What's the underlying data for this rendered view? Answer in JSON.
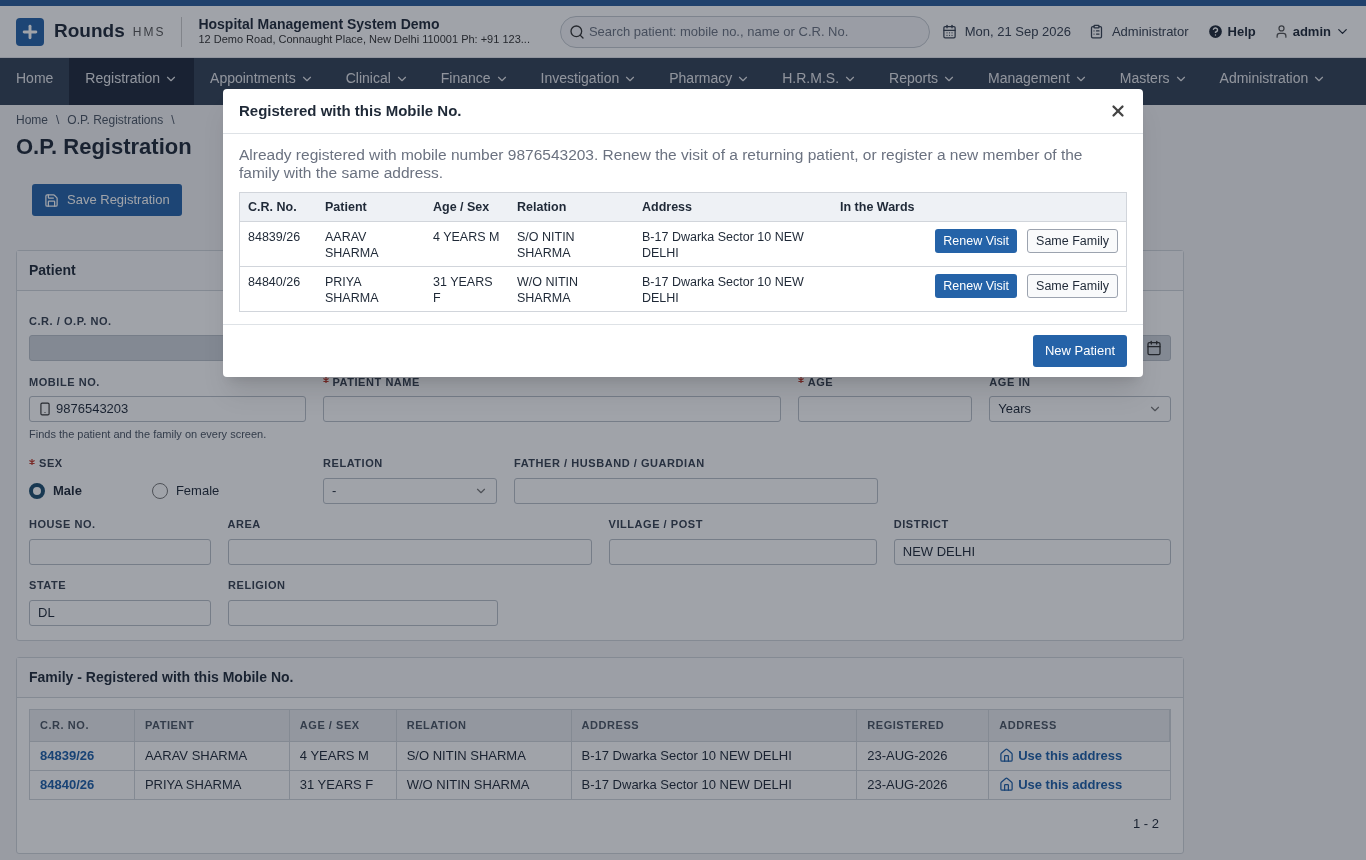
{
  "header": {
    "brand": "Rounds",
    "brand_suffix": "HMS",
    "org_name": "Hospital Management System Demo",
    "org_address": "12 Demo Road, Connaught Place, New Delhi 110001 Ph: +91 123...",
    "search": {
      "placeholder": "Search patient: mobile no., name or C.R. No."
    },
    "date": "Mon, 21 Sep 2026",
    "role": "Administrator",
    "help": "Help",
    "user": "admin"
  },
  "nav": [
    {
      "label": "Home",
      "selected": false,
      "dropdown": false
    },
    {
      "label": "Registration",
      "selected": true,
      "dropdown": true
    },
    {
      "label": "Appointments",
      "selected": false,
      "dropdown": true
    },
    {
      "label": "Clinical",
      "selected": false,
      "dropdown": true
    },
    {
      "label": "Finance",
      "selected": false,
      "dropdown": true
    },
    {
      "label": "Investigation",
      "selected": false,
      "dropdown": true
    },
    {
      "label": "Pharmacy",
      "selected": false,
      "dropdown": true
    },
    {
      "label": "H.R.M.S.",
      "selected": false,
      "dropdown": true
    },
    {
      "label": "Reports",
      "selected": false,
      "dropdown": true
    },
    {
      "label": "Management",
      "selected": false,
      "dropdown": true
    },
    {
      "label": "Masters",
      "selected": false,
      "dropdown": true
    },
    {
      "label": "Administration",
      "selected": false,
      "dropdown": true
    }
  ],
  "breadcrumb": {
    "separator": "\\",
    "items": [
      "Home",
      "O.P. Registrations"
    ]
  },
  "page_title": "O.P. Registration",
  "save_button": "Save Registration",
  "patient_panel": {
    "title": "Patient",
    "rows": [
      [
        {
          "kind": "text",
          "label": "C.R. / O.P. NO.",
          "required": false,
          "disabled": true
        },
        {
          "kind": "date",
          "disabled": true
        }
      ],
      [
        {
          "kind": "phone",
          "label": "MOBILE NO.",
          "required": false,
          "disabled": false,
          "value": "9876543203",
          "hint": "Finds the patient and the family on every screen."
        },
        {
          "kind": "text",
          "label": "PATIENT NAME",
          "required": true,
          "disabled": false
        },
        {
          "kind": "text",
          "label": "AGE",
          "required": true,
          "disabled": false
        },
        {
          "kind": "select",
          "label": "AGE IN",
          "required": false,
          "disabled": false,
          "value": "Years"
        }
      ],
      [
        {
          "kind": "radio",
          "label": "SEX",
          "required": true,
          "options": [
            {
              "label": "Male",
              "selected": true
            },
            {
              "label": "Female",
              "selected": false
            }
          ]
        },
        {
          "kind": "select",
          "label": "RELATION",
          "required": false,
          "disabled": false,
          "value": "-"
        },
        {
          "kind": "text",
          "label": "FATHER / HUSBAND / GUARDIAN",
          "required": false,
          "disabled": false
        }
      ],
      [
        {
          "kind": "text",
          "label": "HOUSE NO.",
          "required": false,
          "disabled": false
        },
        {
          "kind": "text",
          "label": "AREA",
          "required": false,
          "disabled": false
        },
        {
          "kind": "text",
          "label": "VILLAGE / POST",
          "required": false,
          "disabled": false
        },
        {
          "kind": "text",
          "label": "DISTRICT",
          "required": false,
          "disabled": false,
          "value": "NEW DELHI"
        }
      ],
      [
        {
          "kind": "text",
          "label": "STATE",
          "required": false,
          "disabled": false,
          "value": "DL"
        },
        {
          "kind": "text",
          "label": "RELIGION",
          "required": false,
          "disabled": false
        }
      ]
    ]
  },
  "family_panel": {
    "title": "Family - Registered with this Mobile No.",
    "columns": [
      "C.R. NO.",
      "PATIENT",
      "AGE / SEX",
      "RELATION",
      "ADDRESS",
      "REGISTERED",
      "ADDRESS"
    ],
    "rows": [
      {
        "cr_no": "84839/26",
        "patient": "AARAV SHARMA",
        "age_sex": "4 YEARS M",
        "relation": "S/O NITIN SHARMA",
        "address": "B-17 Dwarka Sector 10 NEW DELHI",
        "registered": "23-AUG-2026",
        "action": "Use this address"
      },
      {
        "cr_no": "84840/26",
        "patient": "PRIYA SHARMA",
        "age_sex": "31 YEARS F",
        "relation": "W/O NITIN SHARMA",
        "address": "B-17 Dwarka Sector 10 NEW DELHI",
        "registered": "23-AUG-2026",
        "action": "Use this address"
      }
    ],
    "pager": "1 - 2"
  },
  "modal": {
    "title": "Registered with this Mobile No.",
    "message": "Already registered with mobile number 9876543203. Renew the visit of a returning patient, or register a new member of the family with the same address.",
    "columns": [
      "C.R. No.",
      "Patient",
      "Age / Sex",
      "Relation",
      "Address",
      "In the Wards"
    ],
    "rows": [
      {
        "cr_no": "84839/26",
        "patient": "AARAV SHARMA",
        "age_sex": "4 YEARS M",
        "relation": "S/O NITIN SHARMA",
        "address": "B-17 Dwarka Sector 10 NEW DELHI",
        "renew": "Renew Visit",
        "family": "Same Family"
      },
      {
        "cr_no": "84840/26",
        "patient": "PRIYA SHARMA",
        "age_sex": "31 YEARS F",
        "relation": "W/O NITIN SHARMA",
        "address": "B-17 Dwarka Sector 10 NEW DELHI",
        "renew": "Renew Visit",
        "family": "Same Family"
      }
    ],
    "new_button": "New Patient"
  }
}
